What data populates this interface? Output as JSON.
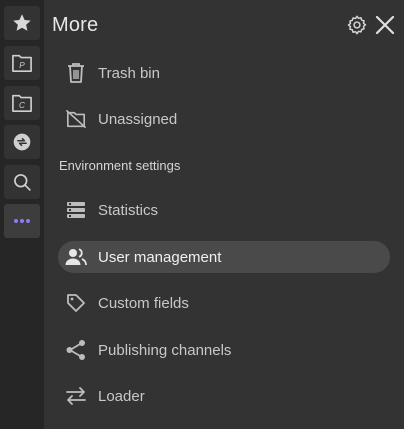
{
  "rail": {
    "items": [
      {
        "name": "favorites",
        "icon": "star-icon"
      },
      {
        "name": "p-folder",
        "icon": "folder-p-icon",
        "letter": "P"
      },
      {
        "name": "c-folder",
        "icon": "folder-c-icon",
        "letter": "C"
      },
      {
        "name": "sync",
        "icon": "sync-icon"
      },
      {
        "name": "search",
        "icon": "search-icon"
      },
      {
        "name": "more",
        "icon": "more-dots-icon",
        "active": true
      }
    ]
  },
  "panel": {
    "title": "More",
    "settings_icon": "gear-icon",
    "close_icon": "close-icon",
    "items_top": [
      {
        "label": "Trash bin",
        "icon": "trash-icon"
      },
      {
        "label": "Unassigned",
        "icon": "unassigned-icon"
      }
    ],
    "section_label": "Environment settings",
    "items_env": [
      {
        "label": "Statistics",
        "icon": "statistics-icon"
      },
      {
        "label": "User management",
        "icon": "users-icon",
        "selected": true
      },
      {
        "label": "Custom fields",
        "icon": "tag-icon"
      },
      {
        "label": "Publishing channels",
        "icon": "share-icon"
      },
      {
        "label": "Loader",
        "icon": "swap-arrows-icon"
      }
    ]
  },
  "colors": {
    "background": "#333333",
    "rail": "#262626",
    "text": "#c8c8c8",
    "selected_bg": "#4a4a4a",
    "accent_more": "#8b7cf6"
  }
}
